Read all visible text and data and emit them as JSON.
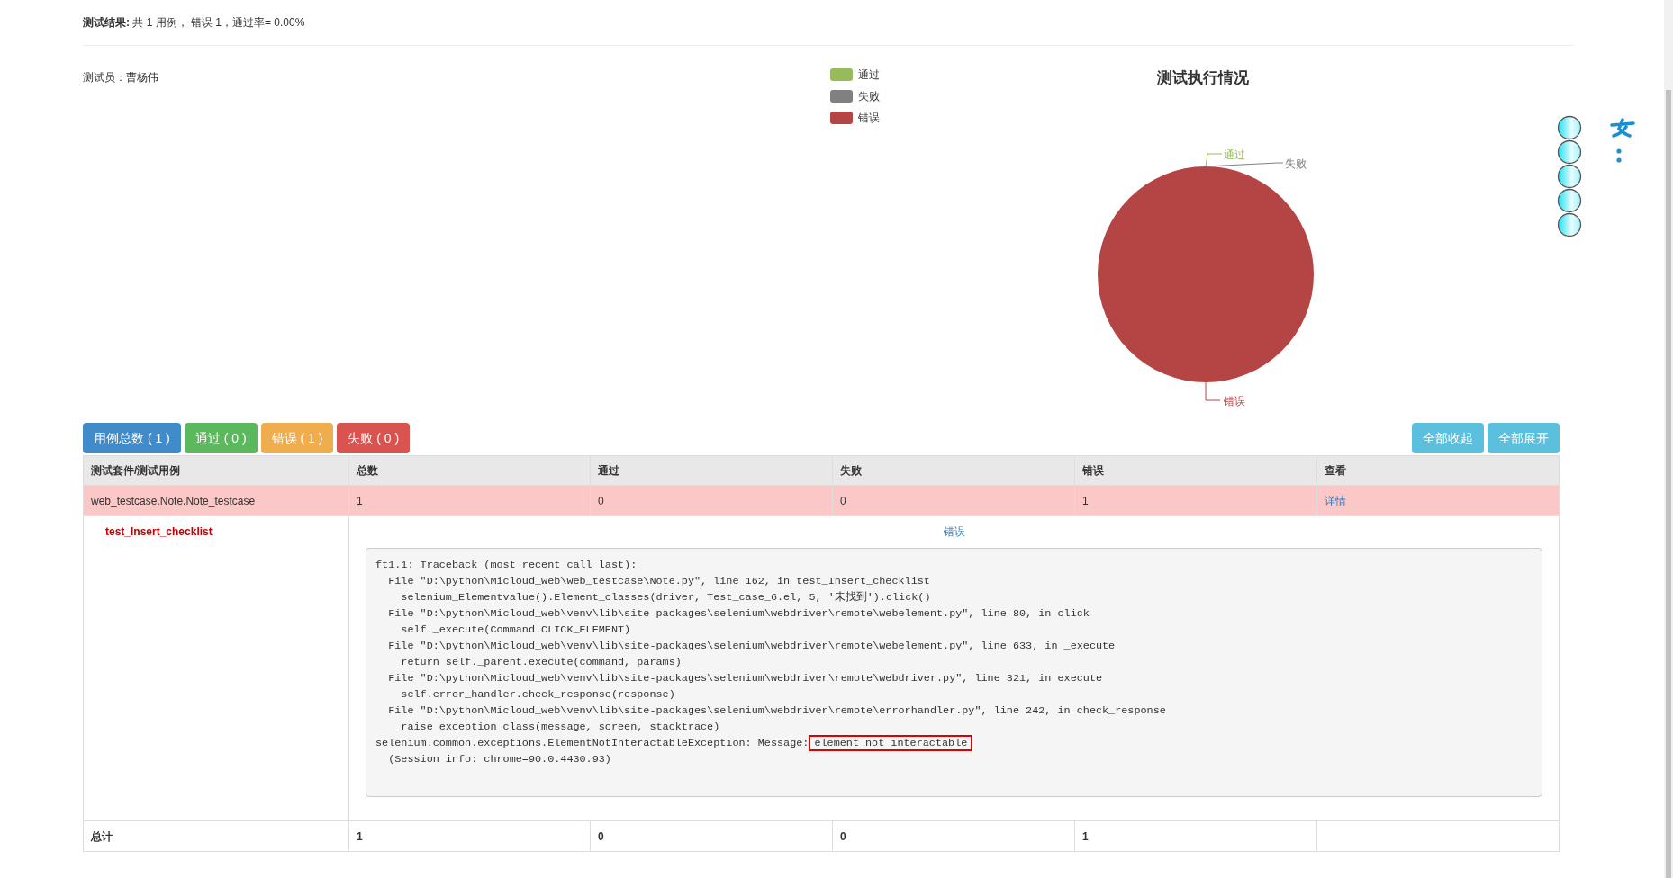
{
  "summary": "**测试结果:** 共 1 用例， 错误 1，通过率= 0.00%",
  "tester": "测试员：曹杨伟",
  "chart_data": {
    "type": "pie",
    "title": "测试执行情况",
    "categories": [
      "通过",
      "失败",
      "错误"
    ],
    "series": [
      {
        "values": [
          0,
          0,
          1
        ]
      }
    ],
    "colors": [
      "#97bb5a",
      "#808080",
      "#b54545"
    ]
  },
  "filter_buttons": [
    {
      "label": "用例总数 ( 1 )",
      "color": "#428bca"
    },
    {
      "label": "通过 ( 0 )",
      "color": "#5cb85c"
    },
    {
      "label": "错误 ( 1 )",
      "color": "#f0ad4e"
    },
    {
      "label": "失败 ( 0 )",
      "color": "#d9534f"
    }
  ],
  "action_buttons": [
    "全部收起",
    "全部展开"
  ],
  "table": {
    "columns": [
      "测试套件/测试用例",
      "总数",
      "通过",
      "失败",
      "错误",
      "查看"
    ],
    "suite_row": {
      "cells": [
        "web_testcase.Note.Note_testcase",
        "1",
        "0",
        "0",
        "1"
      ],
      "link": "详情"
    },
    "case": {
      "name": "test_Insert_checklist",
      "status": "错误",
      "traceback": [
        "ft1.1: Traceback (most recent call last):",
        "  File \"D:\\python\\Micloud_web\\web_testcase\\Note.py\", line 162, in test_Insert_checklist",
        "    selenium_Elementvalue().Element_classes(driver, Test_case_6.el, 5, '未找到').click()",
        "  File \"D:\\python\\Micloud_web\\venv\\lib\\site-packages\\selenium\\webdriver\\remote\\webelement.py\", line 80, in click",
        "    self._execute(Command.CLICK_ELEMENT)",
        "  File \"D:\\python\\Micloud_web\\venv\\lib\\site-packages\\selenium\\webdriver\\remote\\webelement.py\", line 633, in _execute",
        "    return self._parent.execute(command, params)",
        "  File \"D:\\python\\Micloud_web\\venv\\lib\\site-packages\\selenium\\webdriver\\remote\\webdriver.py\", line 321, in execute",
        "    self.error_handler.check_response(response)",
        "  File \"D:\\python\\Micloud_web\\venv\\lib\\site-packages\\selenium\\webdriver\\remote\\errorhandler.py\", line 242, in check_response",
        "    raise exception_class(message, screen, stacktrace)"
      ],
      "exception": "selenium.common.exceptions.ElementNotInteractableException: Message:",
      "highlighted": "element not interactable",
      "session": "  (Session info: chrome=90.0.4430.93)"
    },
    "total_row": [
      "总计",
      "1",
      "0",
      "0",
      "1"
    ]
  }
}
